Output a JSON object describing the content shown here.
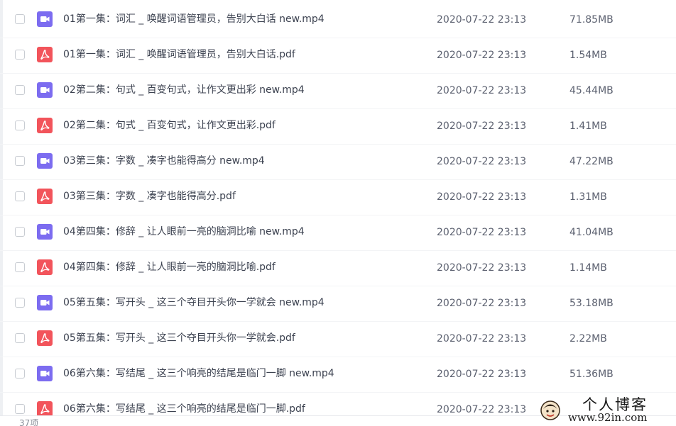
{
  "files": [
    {
      "type": "video",
      "icon": "video-file-icon",
      "name": "01第一集：词汇 _ 唤醒词语管理员，告别大白话 new.mp4",
      "date": "2020-07-22 23:13",
      "size": "71.85MB"
    },
    {
      "type": "pdf",
      "icon": "pdf-file-icon",
      "name": "01第一集：词汇 _ 唤醒词语管理员，告别大白话.pdf",
      "date": "2020-07-22 23:13",
      "size": "1.54MB"
    },
    {
      "type": "video",
      "icon": "video-file-icon",
      "name": "02第二集：句式 _ 百变句式，让作文更出彩 new.mp4",
      "date": "2020-07-22 23:13",
      "size": "45.44MB"
    },
    {
      "type": "pdf",
      "icon": "pdf-file-icon",
      "name": "02第二集：句式 _ 百变句式，让作文更出彩.pdf",
      "date": "2020-07-22 23:13",
      "size": "1.41MB"
    },
    {
      "type": "video",
      "icon": "video-file-icon",
      "name": "03第三集：字数 _ 凑字也能得高分 new.mp4",
      "date": "2020-07-22 23:13",
      "size": "47.22MB"
    },
    {
      "type": "pdf",
      "icon": "pdf-file-icon",
      "name": "03第三集：字数 _ 凑字也能得高分.pdf",
      "date": "2020-07-22 23:13",
      "size": "1.31MB"
    },
    {
      "type": "video",
      "icon": "video-file-icon",
      "name": "04第四集：修辞 _ 让人眼前一亮的脑洞比喻 new.mp4",
      "date": "2020-07-22 23:13",
      "size": "41.04MB"
    },
    {
      "type": "pdf",
      "icon": "pdf-file-icon",
      "name": "04第四集：修辞 _ 让人眼前一亮的脑洞比喻.pdf",
      "date": "2020-07-22 23:13",
      "size": "1.14MB"
    },
    {
      "type": "video",
      "icon": "video-file-icon",
      "name": "05第五集：写开头 _ 这三个夺目开头你一学就会 new.mp4",
      "date": "2020-07-22 23:13",
      "size": "53.18MB"
    },
    {
      "type": "pdf",
      "icon": "pdf-file-icon",
      "name": "05第五集：写开头 _ 这三个夺目开头你一学就会.pdf",
      "date": "2020-07-22 23:13",
      "size": "2.22MB"
    },
    {
      "type": "video",
      "icon": "video-file-icon",
      "name": "06第六集：写结尾 _ 这三个响亮的结尾是临门一脚 new.mp4",
      "date": "2020-07-22 23:13",
      "size": "51.36MB"
    },
    {
      "type": "pdf",
      "icon": "pdf-file-icon",
      "name": "06第六集：写结尾 _ 这三个响亮的结尾是临门一脚.pdf",
      "date": "2020-07-22 23:13",
      "size": ""
    }
  ],
  "footer": {
    "count_label": "37项"
  },
  "watermark": {
    "title": "个人博客",
    "url": "www.92in.com"
  },
  "colors": {
    "video_icon": "#7c6cf0",
    "pdf_icon": "#f2545b",
    "text": "#3c4250",
    "meta_text": "#5c6170"
  }
}
